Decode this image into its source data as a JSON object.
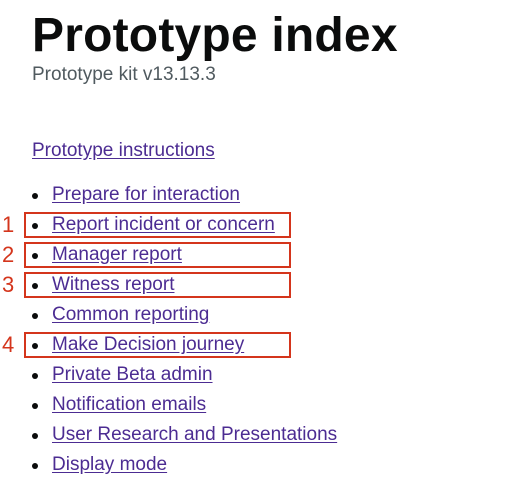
{
  "page": {
    "title": "Prototype index",
    "subtitle": "Prototype kit v13.13.3",
    "instructions_link": "Prototype instructions"
  },
  "links": [
    "Prepare for interaction",
    "Report incident or concern",
    "Manager report",
    "Witness report",
    "Common reporting",
    "Make Decision journey",
    "Private Beta admin",
    "Notification emails",
    "User Research and Presentations",
    "Display mode"
  ],
  "annotations": {
    "color": "#d4351c",
    "labels": [
      "1",
      "2",
      "3",
      "4"
    ]
  },
  "colors": {
    "link": "#4c2c92",
    "text": "#0b0c0c",
    "secondary_text": "#505a5f"
  }
}
